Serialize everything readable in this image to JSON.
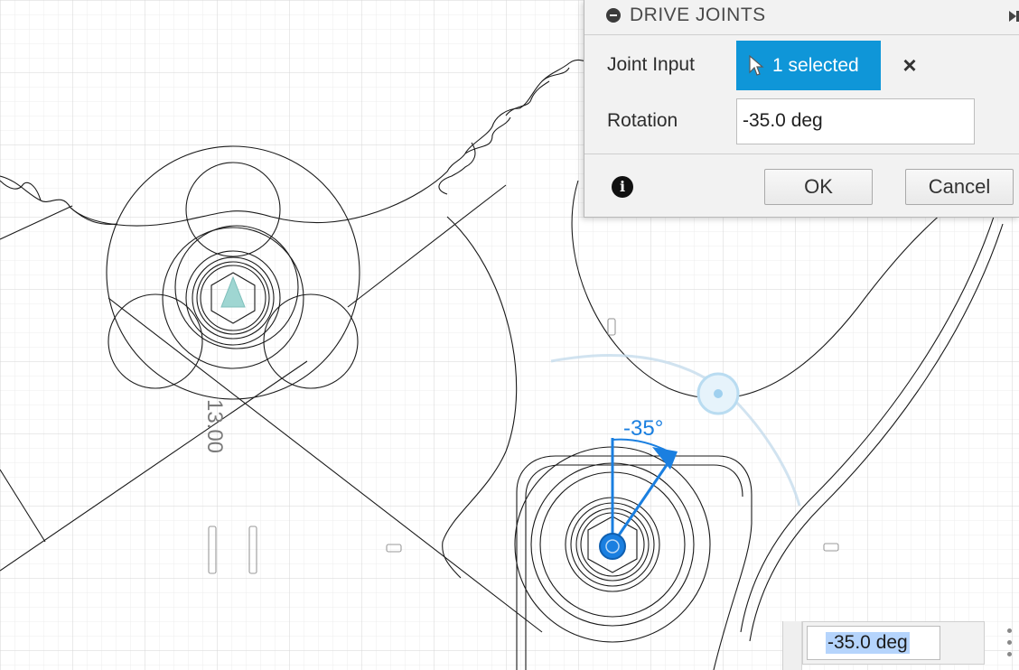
{
  "dialog": {
    "title": "DRIVE JOINTS",
    "joint_input_label": "Joint Input",
    "joint_input_selection": "1 selected",
    "rotation_label": "Rotation",
    "rotation_value": "-35.0 deg",
    "ok_label": "OK",
    "cancel_label": "Cancel",
    "info_icon": "i"
  },
  "canvas": {
    "dimension_label": "13.00",
    "angle_label": "-35°"
  },
  "value_input": {
    "value": "-35.0 deg"
  },
  "colors": {
    "accent": "#0f96d8",
    "manipulator": "#1a7fe0",
    "grid": "#e2e2e2",
    "sketch": "#1a1a1a"
  }
}
